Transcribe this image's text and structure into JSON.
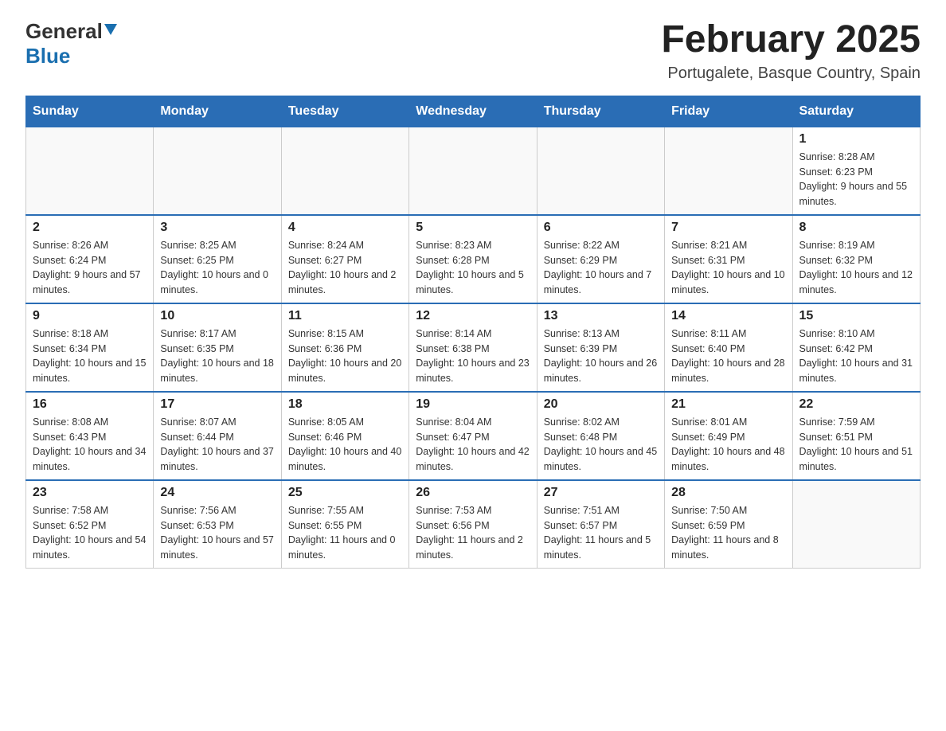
{
  "header": {
    "logo_general": "General",
    "logo_blue": "Blue",
    "month_title": "February 2025",
    "location": "Portugalete, Basque Country, Spain"
  },
  "days_of_week": [
    "Sunday",
    "Monday",
    "Tuesday",
    "Wednesday",
    "Thursday",
    "Friday",
    "Saturday"
  ],
  "weeks": [
    {
      "cells": [
        {
          "day": "",
          "info": ""
        },
        {
          "day": "",
          "info": ""
        },
        {
          "day": "",
          "info": ""
        },
        {
          "day": "",
          "info": ""
        },
        {
          "day": "",
          "info": ""
        },
        {
          "day": "",
          "info": ""
        },
        {
          "day": "1",
          "info": "Sunrise: 8:28 AM\nSunset: 6:23 PM\nDaylight: 9 hours and 55 minutes."
        }
      ]
    },
    {
      "cells": [
        {
          "day": "2",
          "info": "Sunrise: 8:26 AM\nSunset: 6:24 PM\nDaylight: 9 hours and 57 minutes."
        },
        {
          "day": "3",
          "info": "Sunrise: 8:25 AM\nSunset: 6:25 PM\nDaylight: 10 hours and 0 minutes."
        },
        {
          "day": "4",
          "info": "Sunrise: 8:24 AM\nSunset: 6:27 PM\nDaylight: 10 hours and 2 minutes."
        },
        {
          "day": "5",
          "info": "Sunrise: 8:23 AM\nSunset: 6:28 PM\nDaylight: 10 hours and 5 minutes."
        },
        {
          "day": "6",
          "info": "Sunrise: 8:22 AM\nSunset: 6:29 PM\nDaylight: 10 hours and 7 minutes."
        },
        {
          "day": "7",
          "info": "Sunrise: 8:21 AM\nSunset: 6:31 PM\nDaylight: 10 hours and 10 minutes."
        },
        {
          "day": "8",
          "info": "Sunrise: 8:19 AM\nSunset: 6:32 PM\nDaylight: 10 hours and 12 minutes."
        }
      ]
    },
    {
      "cells": [
        {
          "day": "9",
          "info": "Sunrise: 8:18 AM\nSunset: 6:34 PM\nDaylight: 10 hours and 15 minutes."
        },
        {
          "day": "10",
          "info": "Sunrise: 8:17 AM\nSunset: 6:35 PM\nDaylight: 10 hours and 18 minutes."
        },
        {
          "day": "11",
          "info": "Sunrise: 8:15 AM\nSunset: 6:36 PM\nDaylight: 10 hours and 20 minutes."
        },
        {
          "day": "12",
          "info": "Sunrise: 8:14 AM\nSunset: 6:38 PM\nDaylight: 10 hours and 23 minutes."
        },
        {
          "day": "13",
          "info": "Sunrise: 8:13 AM\nSunset: 6:39 PM\nDaylight: 10 hours and 26 minutes."
        },
        {
          "day": "14",
          "info": "Sunrise: 8:11 AM\nSunset: 6:40 PM\nDaylight: 10 hours and 28 minutes."
        },
        {
          "day": "15",
          "info": "Sunrise: 8:10 AM\nSunset: 6:42 PM\nDaylight: 10 hours and 31 minutes."
        }
      ]
    },
    {
      "cells": [
        {
          "day": "16",
          "info": "Sunrise: 8:08 AM\nSunset: 6:43 PM\nDaylight: 10 hours and 34 minutes."
        },
        {
          "day": "17",
          "info": "Sunrise: 8:07 AM\nSunset: 6:44 PM\nDaylight: 10 hours and 37 minutes."
        },
        {
          "day": "18",
          "info": "Sunrise: 8:05 AM\nSunset: 6:46 PM\nDaylight: 10 hours and 40 minutes."
        },
        {
          "day": "19",
          "info": "Sunrise: 8:04 AM\nSunset: 6:47 PM\nDaylight: 10 hours and 42 minutes."
        },
        {
          "day": "20",
          "info": "Sunrise: 8:02 AM\nSunset: 6:48 PM\nDaylight: 10 hours and 45 minutes."
        },
        {
          "day": "21",
          "info": "Sunrise: 8:01 AM\nSunset: 6:49 PM\nDaylight: 10 hours and 48 minutes."
        },
        {
          "day": "22",
          "info": "Sunrise: 7:59 AM\nSunset: 6:51 PM\nDaylight: 10 hours and 51 minutes."
        }
      ]
    },
    {
      "cells": [
        {
          "day": "23",
          "info": "Sunrise: 7:58 AM\nSunset: 6:52 PM\nDaylight: 10 hours and 54 minutes."
        },
        {
          "day": "24",
          "info": "Sunrise: 7:56 AM\nSunset: 6:53 PM\nDaylight: 10 hours and 57 minutes."
        },
        {
          "day": "25",
          "info": "Sunrise: 7:55 AM\nSunset: 6:55 PM\nDaylight: 11 hours and 0 minutes."
        },
        {
          "day": "26",
          "info": "Sunrise: 7:53 AM\nSunset: 6:56 PM\nDaylight: 11 hours and 2 minutes."
        },
        {
          "day": "27",
          "info": "Sunrise: 7:51 AM\nSunset: 6:57 PM\nDaylight: 11 hours and 5 minutes."
        },
        {
          "day": "28",
          "info": "Sunrise: 7:50 AM\nSunset: 6:59 PM\nDaylight: 11 hours and 8 minutes."
        },
        {
          "day": "",
          "info": ""
        }
      ]
    }
  ]
}
